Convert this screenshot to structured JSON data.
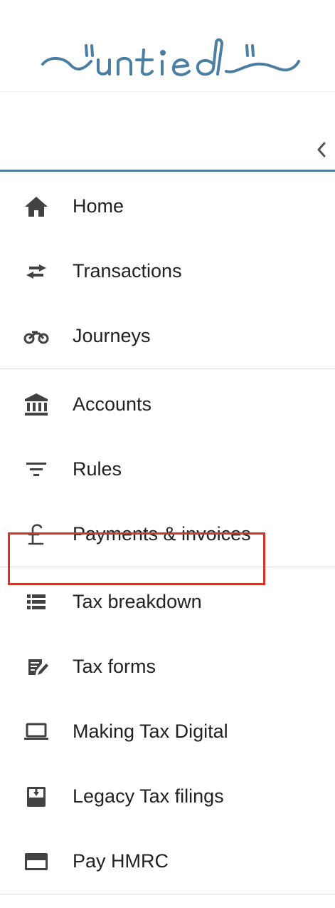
{
  "brand": {
    "logo_text": "\"untied\"",
    "color": "#4a7fa3"
  },
  "sidebar": {
    "collapse_icon": "chevron-left-icon",
    "groups": [
      {
        "items": [
          {
            "label": "Home",
            "icon": "home-icon"
          },
          {
            "label": "Transactions",
            "icon": "swap-arrows-icon"
          },
          {
            "label": "Journeys",
            "icon": "motorbike-icon"
          }
        ]
      },
      {
        "items": [
          {
            "label": "Accounts",
            "icon": "bank-icon"
          },
          {
            "label": "Rules",
            "icon": "filter-icon"
          },
          {
            "label": "Payments & invoices",
            "icon": "pound-icon"
          }
        ]
      },
      {
        "items": [
          {
            "label": "Tax breakdown",
            "icon": "list-icon"
          },
          {
            "label": "Tax forms",
            "icon": "form-edit-icon"
          },
          {
            "label": "Making Tax Digital",
            "icon": "laptop-icon",
            "highlighted": true
          },
          {
            "label": "Legacy Tax filings",
            "icon": "archive-icon"
          },
          {
            "label": "Pay HMRC",
            "icon": "credit-card-icon"
          }
        ]
      }
    ]
  },
  "colors": {
    "accent": "#4a7fa3",
    "highlight_border": "#d0362a",
    "icon": "#424242",
    "divider": "#dcdcdc"
  }
}
